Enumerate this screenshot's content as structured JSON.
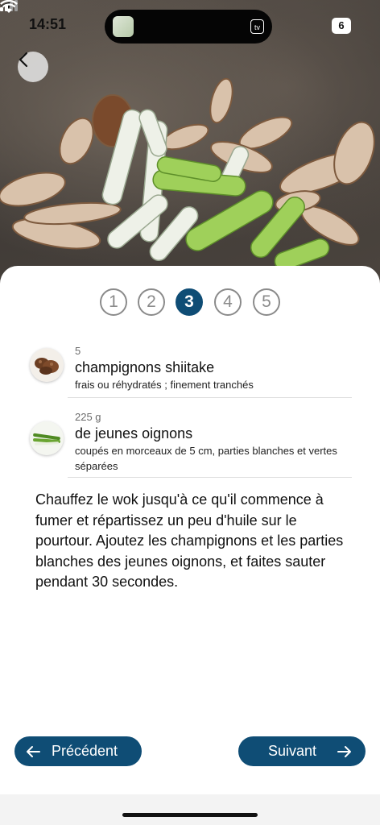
{
  "status_bar": {
    "time": "14:51",
    "island_badge": "tv",
    "battery": "6"
  },
  "stepper": {
    "steps": [
      "1",
      "2",
      "3",
      "4",
      "5"
    ],
    "active_index": 2
  },
  "ingredients": [
    {
      "quantity": "5",
      "name": "champignons shiitake",
      "note": "frais ou réhydratés ; finement tranchés"
    },
    {
      "quantity": "225 g",
      "name": "de jeunes oignons",
      "note": "coupés en morceaux de 5 cm, parties blanches et vertes séparées"
    }
  ],
  "instructions": "Chauffez le wok jusqu'à ce qu'il commence à fumer et répartissez un peu d'huile sur le pourtour. Ajoutez les champignons et les parties blanches des jeunes oignons, et faites sauter pendant 30 secondes.",
  "navigation": {
    "previous_label": "Précédent",
    "next_label": "Suivant"
  },
  "colors": {
    "accent": "#0f4d75",
    "step_inactive": "#8a8a8a"
  }
}
